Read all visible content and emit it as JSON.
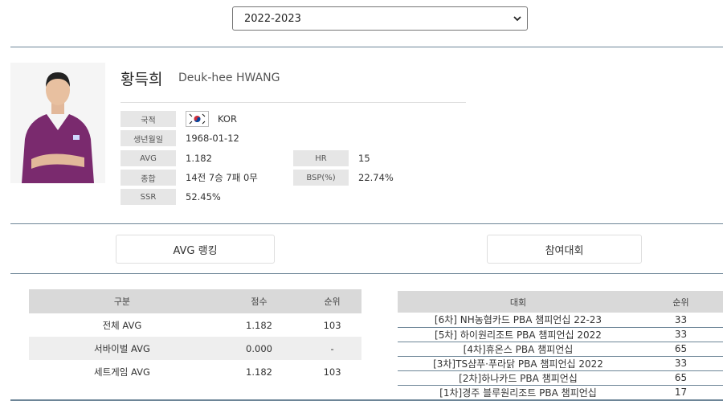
{
  "season": {
    "selected": "2022-2023"
  },
  "player": {
    "name_ko": "황득희",
    "name_en": "Deuk-hee HWANG",
    "info": {
      "nationality_label": "국적",
      "nationality_value": "KOR",
      "birth_label": "생년월일",
      "birth_value": "1968-01-12",
      "avg_label": "AVG",
      "avg_value": "1.182",
      "hr_label": "HR",
      "hr_value": "15",
      "record_label": "종합",
      "record_value": "14전 7승 7패 0무",
      "bsp_label": "BSP(%)",
      "bsp_value": "22.74%",
      "ssr_label": "SSR",
      "ssr_value": "52.45%"
    }
  },
  "tabs": {
    "avg_ranking": "AVG 랭킹",
    "tournaments": "참여대회"
  },
  "avg_ranking_table": {
    "headers": [
      "구분",
      "점수",
      "순위"
    ],
    "rows": [
      [
        "전체 AVG",
        "1.182",
        "103"
      ],
      [
        "서바이벌 AVG",
        "0.000",
        "-"
      ],
      [
        "세트게임 AVG",
        "1.182",
        "103"
      ]
    ]
  },
  "tournament_table": {
    "headers": [
      "대회",
      "순위"
    ],
    "rows": [
      [
        "[6차] NH농협카드 PBA 챔피언십 22-23",
        "33"
      ],
      [
        "[5차] 하이원리조트 PBA 챔피언십 2022",
        "33"
      ],
      [
        "[4차]휴온스 PBA 챔피언십",
        "65"
      ],
      [
        "[3차]TS샴푸·푸라닭 PBA 챔피언십 2022",
        "33"
      ],
      [
        "[2차]하나카드 PBA 챔피언십",
        "65"
      ],
      [
        "[1차]경주 블루원리조트 PBA 챔피언십",
        "17"
      ]
    ]
  },
  "colors": {
    "divider": "#6d8597",
    "header_bg": "#d9d9d9",
    "label_bg": "#e6e6e6",
    "shirt": "#7a2a6e"
  },
  "icons": {
    "select": "chevron-down-icon",
    "flag": "korea-flag-icon"
  }
}
